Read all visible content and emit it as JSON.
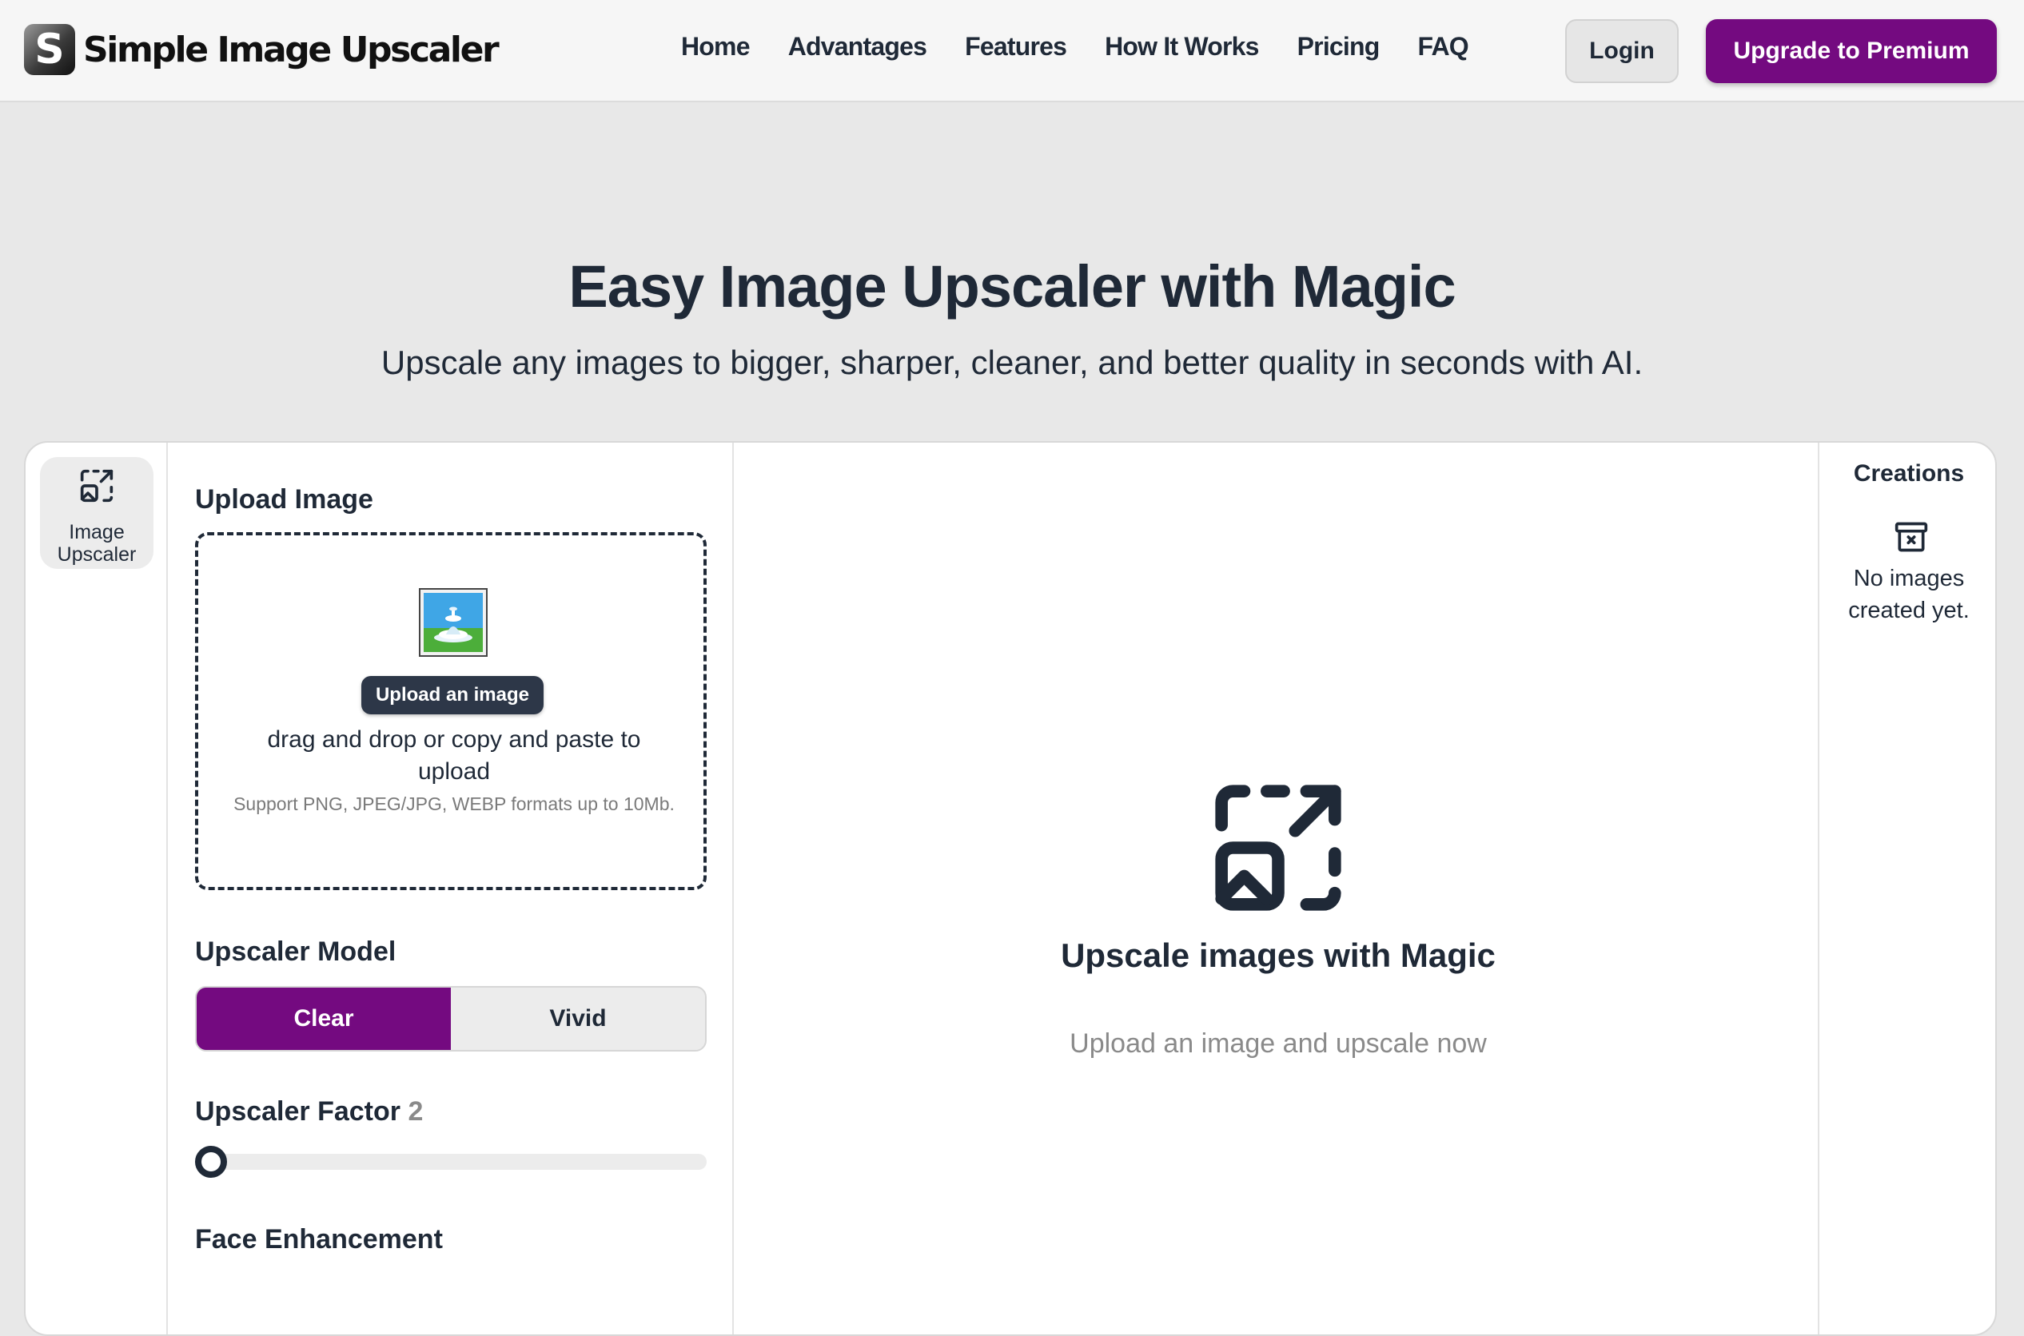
{
  "header": {
    "logo_letter": "S",
    "logo_text": "Simple Image Upscaler",
    "nav": [
      "Home",
      "Advantages",
      "Features",
      "How It Works",
      "Pricing",
      "FAQ"
    ],
    "login_label": "Login",
    "premium_label": "Upgrade to Premium"
  },
  "hero": {
    "title": "Easy Image Upscaler with Magic",
    "subtitle": "Upscale any images to bigger, sharper, cleaner, and better quality in seconds with AI."
  },
  "sidebar": {
    "tool_label": "Image Upscaler",
    "tool_icon": "image-upscale-icon"
  },
  "panel": {
    "upload_heading": "Upload Image",
    "upload_button": "Upload an image",
    "upload_hint": "drag and drop or copy and paste to upload",
    "upload_support": "Support PNG, JPEG/JPG, WEBP formats up to 10Mb.",
    "model_heading": "Upscaler Model",
    "models": [
      "Clear",
      "Vivid"
    ],
    "selected_model": "Clear",
    "factor_heading": "Upscaler Factor",
    "factor_value": "2",
    "factor_slider_fraction": 0.0,
    "face_heading": "Face Enhancement"
  },
  "main": {
    "title": "Upscale images with Magic",
    "subtitle": "Upload an image and upscale now"
  },
  "creations": {
    "title": "Creations",
    "empty_text": "No images created yet."
  },
  "colors": {
    "accent": "#740a80",
    "text": "#1f2937",
    "muted": "#8a8a8a",
    "page_bg": "#e8e8e8"
  }
}
